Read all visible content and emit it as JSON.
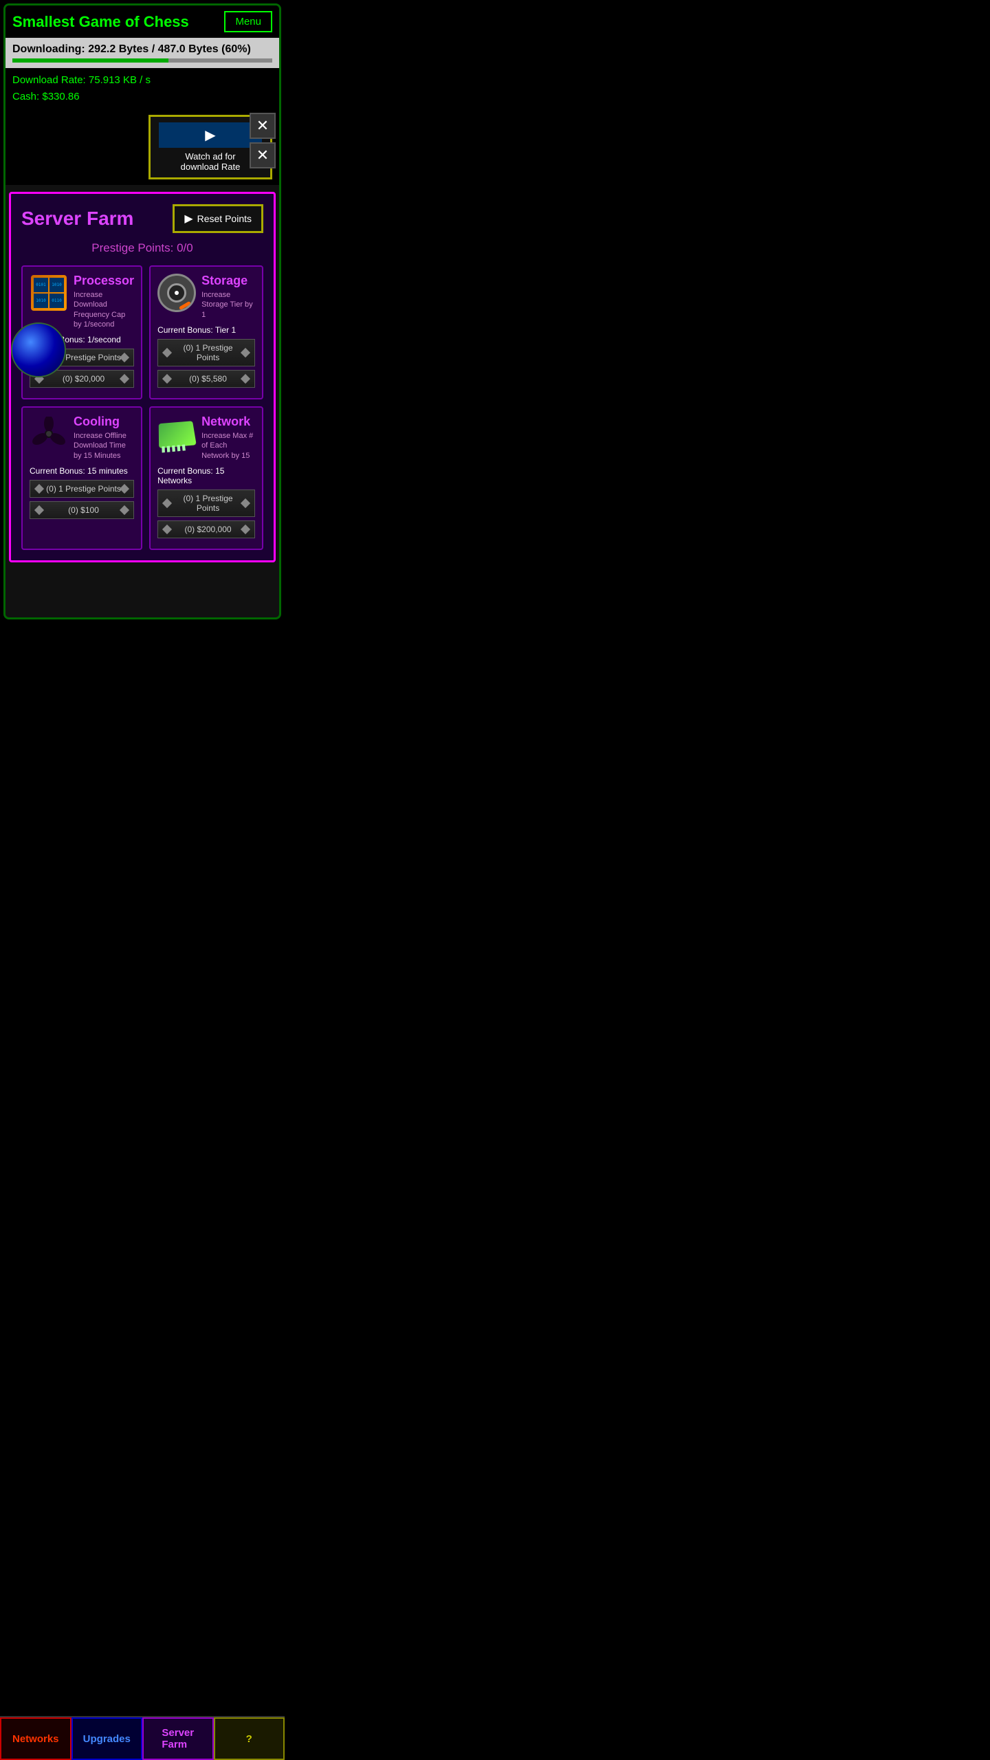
{
  "app": {
    "title": "Smallest Game of Chess",
    "menu_label": "Menu"
  },
  "download": {
    "text": "Downloading: 292.2 Bytes / 487.0 Bytes (60%)",
    "progress_pct": 60
  },
  "stats": {
    "download_rate": "Download Rate: 75.913 KB / s",
    "cash": "Cash: $330.86"
  },
  "watch_ad": {
    "label": "Watch ad for\ndownload Rate"
  },
  "dialog": {
    "title": "Server Farm",
    "reset_points_label": "Reset Points",
    "prestige_points": "Prestige Points: 0/0",
    "cards": [
      {
        "name": "Processor",
        "description": "Increase Download Frequency Cap by 1/second",
        "current_bonus": "Current Bonus: 1/second",
        "btn1": "(0) 1 Prestige Points",
        "btn2": "(0) $20,000",
        "icon_type": "processor"
      },
      {
        "name": "Storage",
        "description": "Increase Storage Tier by 1",
        "current_bonus": "Current Bonus: Tier 1",
        "btn1": "(0) 1 Prestige Points",
        "btn2": "(0) $5,580",
        "icon_type": "storage"
      },
      {
        "name": "Cooling",
        "description": "Increase Offline Download Time by 15 Minutes",
        "current_bonus": "Current Bonus: 15 minutes",
        "btn1": "(0) 1 Prestige Points",
        "btn2": "(0) $100",
        "icon_type": "cooling"
      },
      {
        "name": "Network",
        "description": "Increase Max # of Each Network by 15",
        "current_bonus": "Current Bonus: 15 Networks",
        "btn1": "(0) 1 Prestige Points",
        "btn2": "(0) $200,000",
        "icon_type": "network"
      }
    ]
  },
  "bottom_nav": {
    "networks": "Networks",
    "upgrades": "Upgrades",
    "server_farm": "Server\nFarm",
    "question": "?"
  }
}
